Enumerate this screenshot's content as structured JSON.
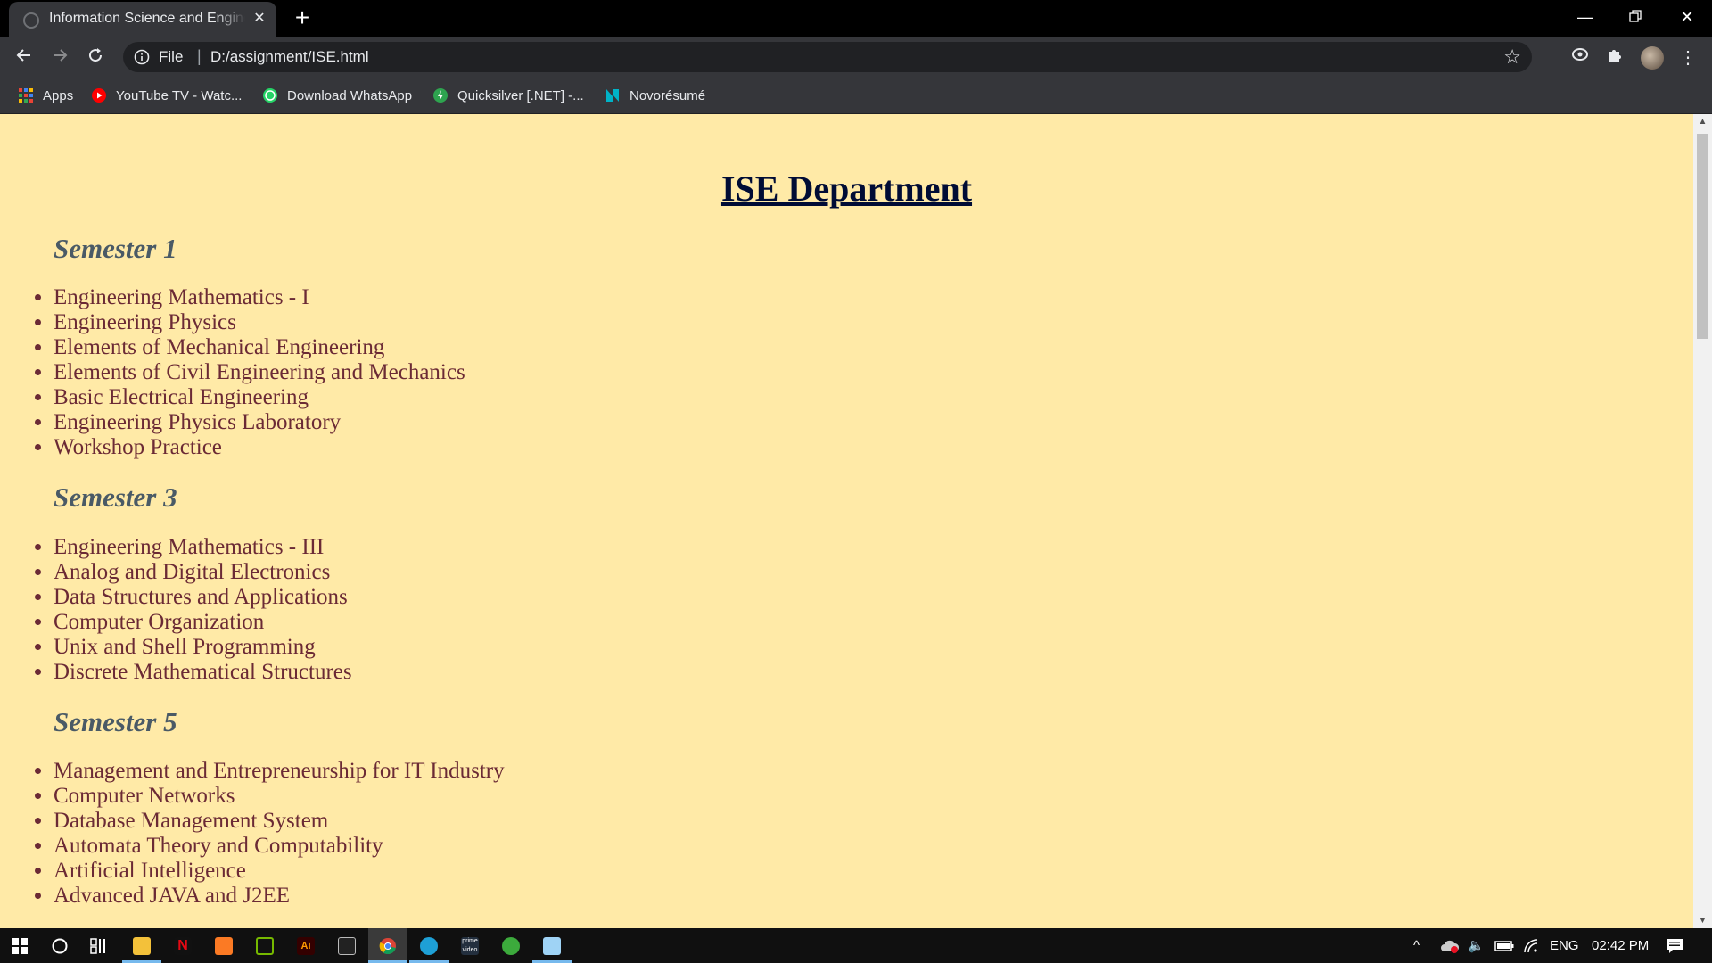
{
  "browser": {
    "tab": {
      "title": "Information Science and Engineering"
    },
    "omnibox": {
      "scheme": "File",
      "url": "D:/assignment/ISE.html"
    },
    "bookmarks": [
      {
        "label": "Apps",
        "icon": "apps-grid-icon",
        "color": "#ea4335"
      },
      {
        "label": "YouTube TV - Watc...",
        "icon": "youtube-icon",
        "color": "#ff0000"
      },
      {
        "label": "Download WhatsApp",
        "icon": "whatsapp-icon",
        "color": "#25d366"
      },
      {
        "label": "Quicksilver [.NET] -...",
        "icon": "quicksilver-icon",
        "color": "#2ea44f"
      },
      {
        "label": "Novorésumé",
        "icon": "novoresume-icon",
        "color": "#00b3c7"
      }
    ]
  },
  "page": {
    "background": "#ffeaa7",
    "title": "ISE Department",
    "semesters": [
      {
        "heading": "Semester 1",
        "subjects": [
          "Engineering Mathematics - I",
          "Engineering Physics",
          "Elements of Mechanical Engineering",
          "Elements of Civil Engineering and Mechanics",
          "Basic Electrical Engineering",
          "Engineering Physics Laboratory",
          "Workshop Practice"
        ]
      },
      {
        "heading": "Semester 3",
        "subjects": [
          "Engineering Mathematics - III",
          "Analog and Digital Electronics",
          "Data Structures and Applications",
          "Computer Organization",
          "Unix and Shell Programming",
          "Discrete Mathematical Structures"
        ]
      },
      {
        "heading": "Semester 5",
        "subjects": [
          "Management and Entrepreneurship for IT Industry",
          "Computer Networks",
          "Database Management System",
          "Automata Theory and Computability",
          "Artificial Intelligence",
          "Advanced JAVA and J2EE"
        ]
      }
    ]
  },
  "taskbar": {
    "tray": {
      "language": "ENG",
      "time": "02:42 PM"
    }
  }
}
